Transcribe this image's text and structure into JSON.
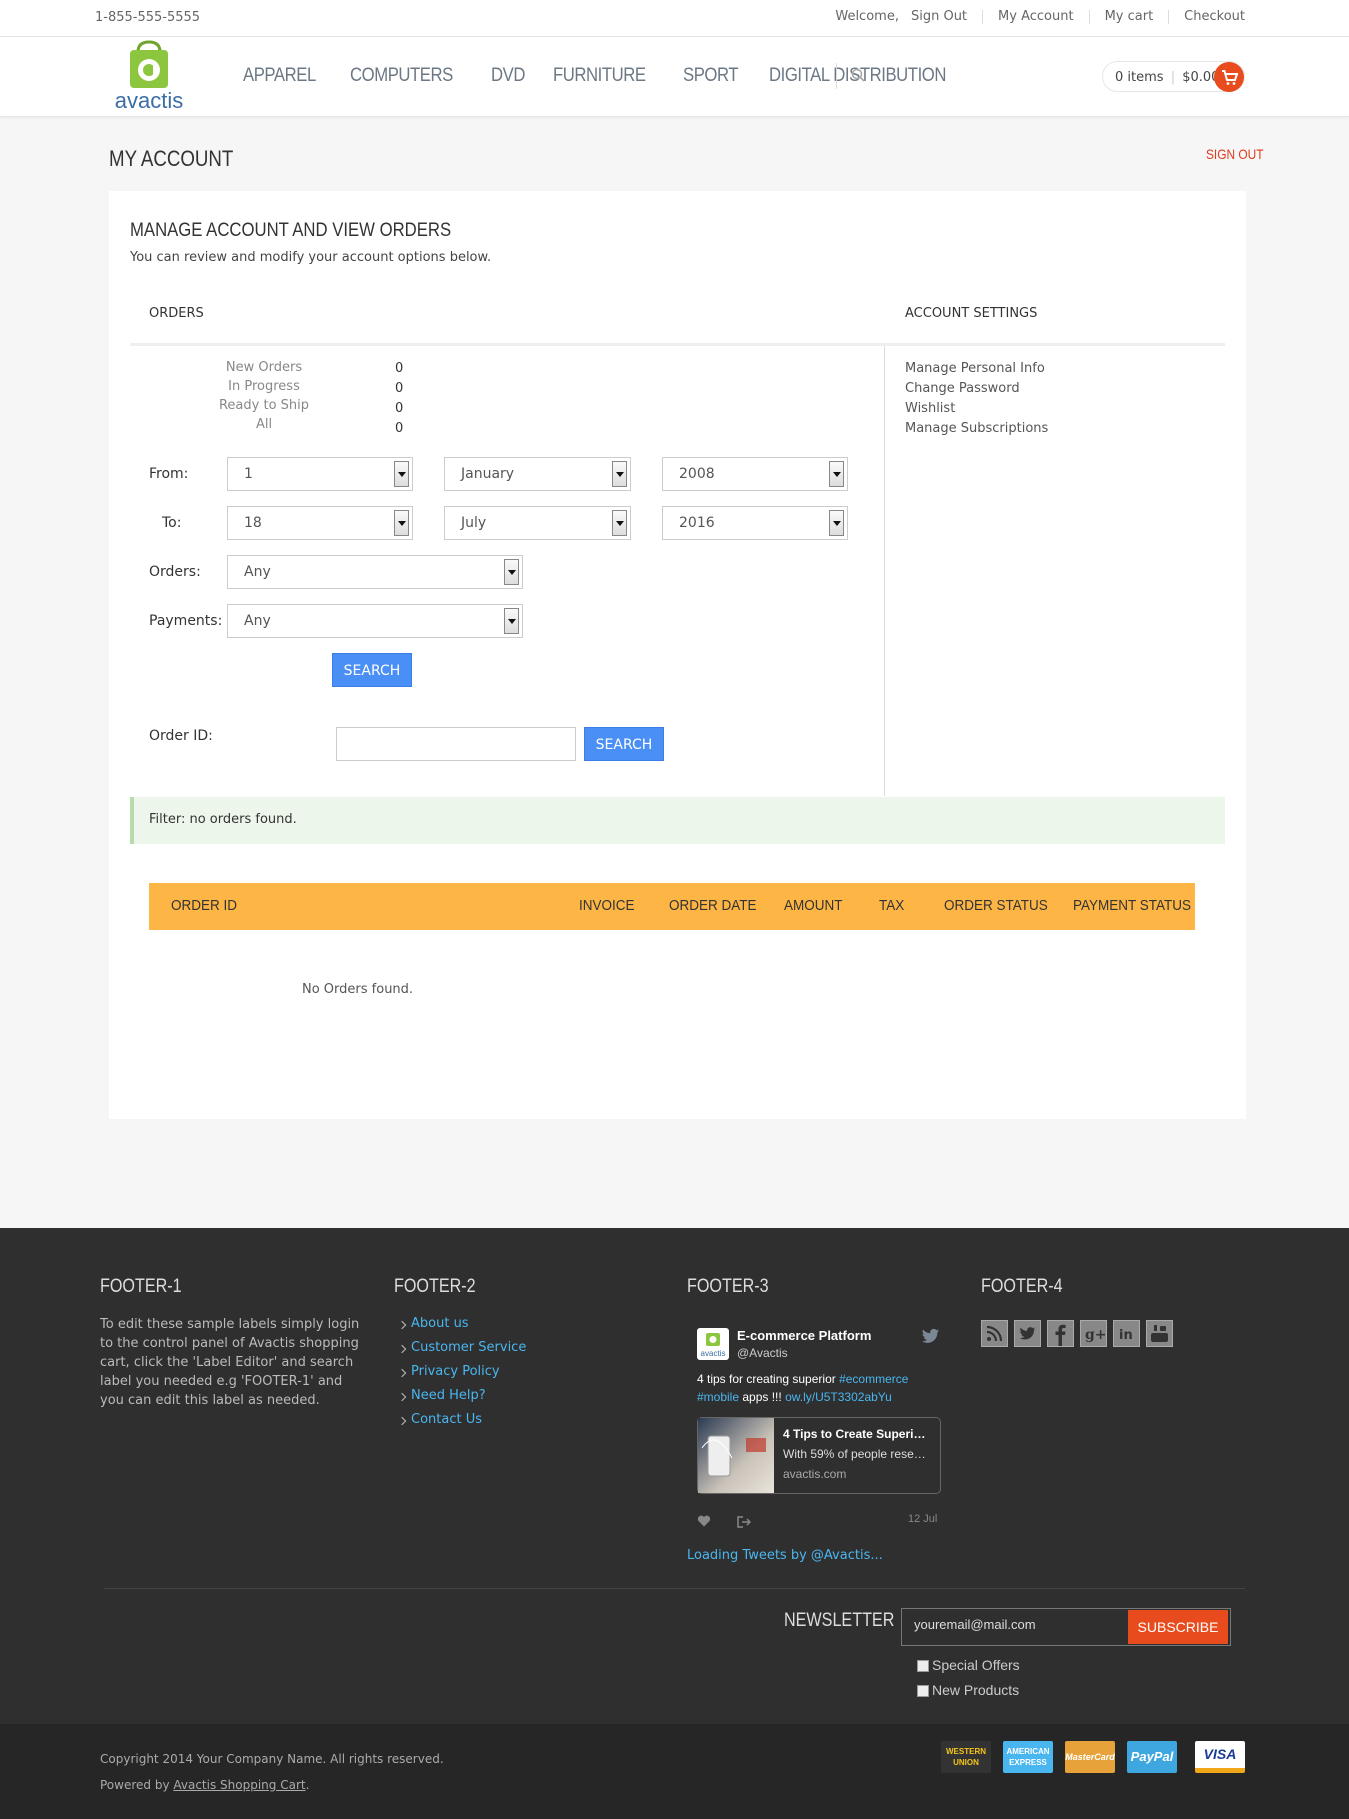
{
  "topbar": {
    "phone": "1-855-555-5555",
    "welcome": "Welcome,",
    "sign_out": "Sign Out",
    "my_account": "My Account",
    "my_cart": "My cart",
    "checkout": "Checkout"
  },
  "header": {
    "logo_text": "avactis",
    "nav": [
      "APPAREL",
      "COMPUTERS",
      "DVD",
      "FURNITURE",
      "SPORT",
      "DIGITAL DISTRIBUTION"
    ],
    "cart_items": "0 items",
    "cart_total": "$0.00"
  },
  "page": {
    "title": "MY ACCOUNT",
    "sign_out": "SIGN OUT",
    "section_title": "MANAGE ACCOUNT AND VIEW ORDERS",
    "section_desc": "You can review and modify your account options below."
  },
  "orders": {
    "heading": "ORDERS",
    "stats": [
      {
        "label": "New Orders",
        "value": "0"
      },
      {
        "label": "In Progress",
        "value": "0"
      },
      {
        "label": "Ready to Ship",
        "value": "0"
      },
      {
        "label": "All",
        "value": "0"
      }
    ],
    "from_label": "From:",
    "from_day": "1",
    "from_month": "January",
    "from_year": "2008",
    "to_label": "To:",
    "to_day": "18",
    "to_month": "July",
    "to_year": "2016",
    "orders_label": "Orders:",
    "orders_value": "Any",
    "payments_label": "Payments:",
    "payments_value": "Any",
    "search_button": "SEARCH",
    "order_id_label": "Order ID:",
    "order_id_value": "",
    "order_id_search_button": "SEARCH"
  },
  "account_settings": {
    "heading": "ACCOUNT SETTINGS",
    "links": [
      "Manage Personal Info",
      "Change Password",
      "Wishlist",
      "Manage Subscriptions"
    ]
  },
  "notice": "Filter: no orders found.",
  "table": {
    "columns": [
      "ORDER ID",
      "INVOICE",
      "ORDER DATE",
      "AMOUNT",
      "TAX",
      "ORDER STATUS",
      "PAYMENT STATUS"
    ],
    "empty_text": "No Orders found."
  },
  "footer": {
    "col1_title": "FOOTER-1",
    "col1_text": "To edit these sample labels simply login to the control panel of Avactis shopping cart, click the 'Label Editor' and search label you needed e.g 'FOOTER-1' and you can edit this label as needed.",
    "col2_title": "FOOTER-2",
    "col2_links": [
      "About us",
      "Customer Service",
      "Privacy Policy",
      "Need Help?",
      "Contact Us"
    ],
    "col3_title": "FOOTER-3",
    "col4_title": "FOOTER-4",
    "tweet": {
      "name": "E-commerce Platform",
      "handle": "@Avactis",
      "text_plain": "4 tips for creating superior ",
      "hashtag1": "#ecommerce",
      "hashtag2": "#mobile",
      "text_mid": " apps !!! ",
      "link": "ow.ly/U5T3302abYu",
      "card_title": "4 Tips to Create Superi…",
      "card_desc": "With 59% of people rese…",
      "card_domain": "avactis.com",
      "date": "12 Jul",
      "loading": "Loading Tweets by @Avactis..."
    },
    "social_icons": [
      "rss-icon",
      "twitter-icon",
      "facebook-icon",
      "google-plus-icon",
      "linkedin-icon",
      "youtube-icon"
    ],
    "newsletter_title": "NEWSLETTER",
    "newsletter_placeholder": "youremail@mail.com",
    "subscribe_button": "SUBSCRIBE",
    "checkboxes": [
      "Special Offers",
      "New Products"
    ],
    "copyright": "Copyright 2014 Your Company Name. All rights reserved.",
    "powered_prefix": "Powered by ",
    "powered_link": "Avactis Shopping Cart",
    "powered_suffix": ".",
    "payments": [
      "WESTERN UNION",
      "AMERICAN EXPRESS",
      "MasterCard",
      "PayPal",
      "VISA"
    ]
  },
  "colors": {
    "accent_orange": "#e84c1e",
    "table_header": "#fdb645",
    "button_blue": "#4a8ff5",
    "link_blue": "#4ab6ef",
    "logo_green": "#8cc63f"
  }
}
